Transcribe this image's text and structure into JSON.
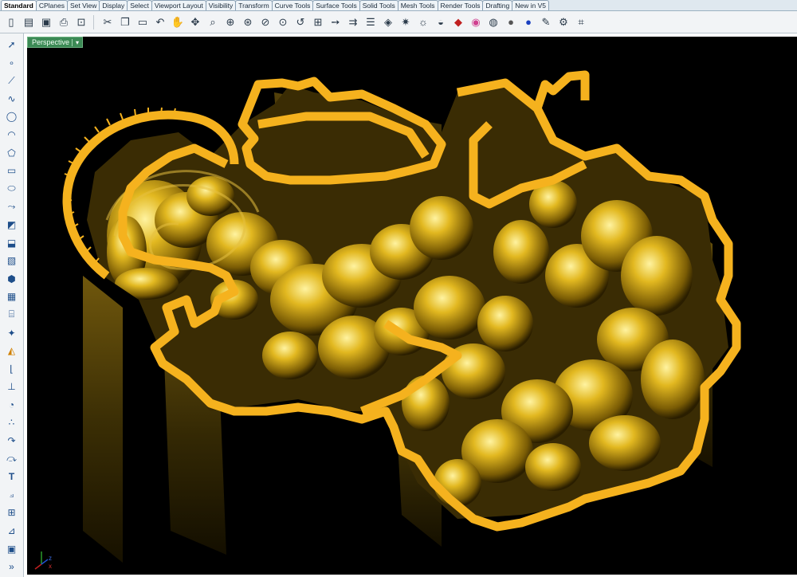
{
  "tabs": [
    "Standard",
    "CPlanes",
    "Set View",
    "Display",
    "Select",
    "Viewport Layout",
    "Visibility",
    "Transform",
    "Curve Tools",
    "Surface Tools",
    "Solid Tools",
    "Mesh Tools",
    "Render Tools",
    "Drafting",
    "New in V5"
  ],
  "active_tab": "Standard",
  "toolbar_icons": [
    "new-icon",
    "open-icon",
    "save-icon",
    "print-icon",
    "import-icon",
    "cut-icon",
    "copy-icon",
    "paste-icon",
    "undo-icon",
    "pan-icon",
    "rotate-icon",
    "zoom-icon",
    "zoom-window-icon",
    "zoom-extents-icon",
    "zoom-selected-icon",
    "zoom-target-icon",
    "undo-view-icon",
    "grid-icon",
    "move-icon",
    "copy-object-icon",
    "properties-icon",
    "layers-icon",
    "light-icon",
    "bulb-icon",
    "analyze-icon",
    "render-icon",
    "color-wheel-icon",
    "material-icon",
    "sphere-icon",
    "render-sphere-icon",
    "options-icon",
    "gear-icon",
    "help-icon"
  ],
  "left_toolbar_icons": [
    "select-icon",
    "point-icon",
    "polyline-icon",
    "curve-icon",
    "circle-icon",
    "arc-icon",
    "polygon-icon",
    "rectangle-icon",
    "ellipse-icon",
    "free-curve-icon",
    "surface-icon",
    "extrude-icon",
    "box-icon",
    "solid-icon",
    "mesh-icon",
    "cylinder-icon",
    "edit-icon",
    "boolean-icon",
    "fillet-icon",
    "offset-icon",
    "dimension-icon",
    "grid-snap-icon",
    "text-icon",
    "block-icon",
    "group-icon",
    "analyze-icon",
    "transform-icon",
    "cube-icon",
    "more-icon"
  ],
  "viewport": {
    "title": "Perspective",
    "dropdown_glyph": "▾"
  },
  "axes": {
    "x": "x",
    "y": "y",
    "z": "z"
  },
  "colors": {
    "viewport_bg": "#000000",
    "outline": "#f5b21e",
    "relief": "#b8920c",
    "tab_active": "#3c8a55"
  }
}
